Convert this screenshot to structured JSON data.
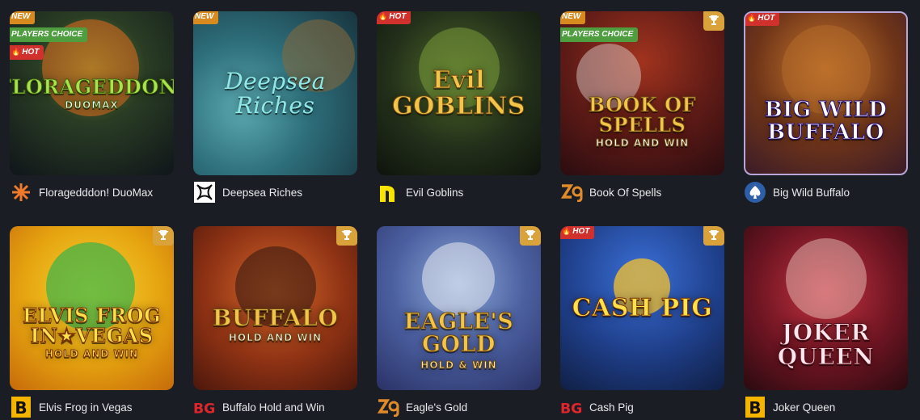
{
  "badge_labels": {
    "new": "NEW",
    "players_choice": "PLAYERS CHOICE",
    "hot": "HOT"
  },
  "rows": [
    [
      {
        "name": "Floragedddon! DuoMax",
        "art_title": "FLORAGEDDON!",
        "art_sub": "DUOMAX",
        "provider_icon": "yggdrasil-logo",
        "badges": [
          "new",
          "players_choice",
          "hot"
        ],
        "trophy": false
      },
      {
        "name": "Deepsea Riches",
        "art_title": "Deepsea Riches",
        "art_sub": "",
        "provider_icon": "knot-logo",
        "badges": [
          "new"
        ],
        "trophy": false
      },
      {
        "name": "Evil Goblins",
        "art_title": "Evil GOBLINS",
        "art_sub": "",
        "provider_icon": "n-logo",
        "badges": [
          "hot"
        ],
        "trophy": false
      },
      {
        "name": "Book Of Spells",
        "art_title": "BOOK OF SPELLS",
        "art_sub": "HOLD AND WIN",
        "provider_icon": "zg-logo",
        "badges": [
          "new",
          "players_choice"
        ],
        "trophy": true
      },
      {
        "name": "Big Wild Buffalo",
        "art_title": "BIG WILD BUFFALO",
        "art_sub": "",
        "provider_icon": "spade-logo",
        "badges": [
          "hot"
        ],
        "trophy": false
      }
    ],
    [
      {
        "name": "Elvis Frog in Vegas",
        "art_title": "ELVIS FROG IN★VEGAS",
        "art_sub": "HOLD AND WIN",
        "provider_icon": "b-logo",
        "badges": [],
        "trophy": true
      },
      {
        "name": "Buffalo Hold and Win",
        "art_title": "BUFFALO",
        "art_sub": "HOLD AND WIN",
        "provider_icon": "bg-logo",
        "badges": [],
        "trophy": true
      },
      {
        "name": "Eagle's Gold",
        "art_title": "EAGLE'S GOLD",
        "art_sub": "HOLD & WIN",
        "provider_icon": "zg-logo",
        "badges": [],
        "trophy": true
      },
      {
        "name": "Cash Pig",
        "art_title": "CASH PIG",
        "art_sub": "",
        "provider_icon": "bg-logo",
        "badges": [
          "hot"
        ],
        "trophy": true
      },
      {
        "name": "Joker Queen",
        "art_title": "JOKER QUEEN",
        "art_sub": "",
        "provider_icon": "b-logo",
        "badges": [],
        "trophy": false
      }
    ]
  ],
  "colors": {
    "page_bg": "#1b1d24",
    "new": "#d88a1f",
    "players_choice": "#4e9e3f",
    "hot": "#d0312d",
    "trophy": "#d9a23a"
  }
}
